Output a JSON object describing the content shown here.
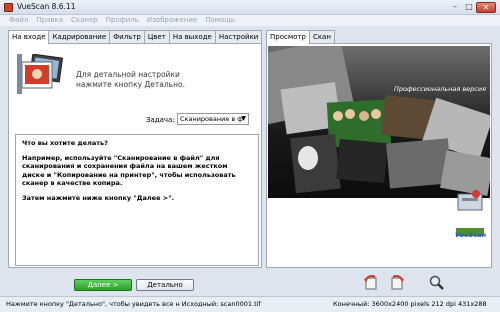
{
  "window": {
    "title": "VueScan 8.6.11"
  },
  "menu": [
    "Файл",
    "Правка",
    "Сканер",
    "Профиль",
    "Изображение",
    "Помощь"
  ],
  "left_tabs": [
    "На входе",
    "Кадрирование",
    "Фильтр",
    "Цвет",
    "На выходе",
    "Настройки"
  ],
  "right_tabs": [
    "Просмотр",
    "Скан"
  ],
  "hint": {
    "line1": "Для детальной настройки",
    "line2": "нажмите кнопку Детально."
  },
  "task": {
    "label": "Задача:",
    "value": "Сканирование в ф"
  },
  "help": {
    "p1": "Что вы хотите делать?",
    "p2": "Например, используйте \"Сканирование в файл\" для сканирования и сохранения файла на вашем жестком диске и \"Копирование на принтер\", чтобы использовать сканер в качестве копира.",
    "p3": "Затем нажмите ниже кнопку \"Далее >\"."
  },
  "buttons": {
    "next": "Далее >",
    "detail": "Детально"
  },
  "preview": {
    "pro_label": "Профессиональная версия",
    "logo_text": "VueScan"
  },
  "status": {
    "left": "Нажмите кнопку \"Детально\", чтобы увидеть все н  Исходный:  scan0001.tif",
    "right": "Конечный:  3600x2400 pixels 212 dpi 431x288 mm"
  }
}
